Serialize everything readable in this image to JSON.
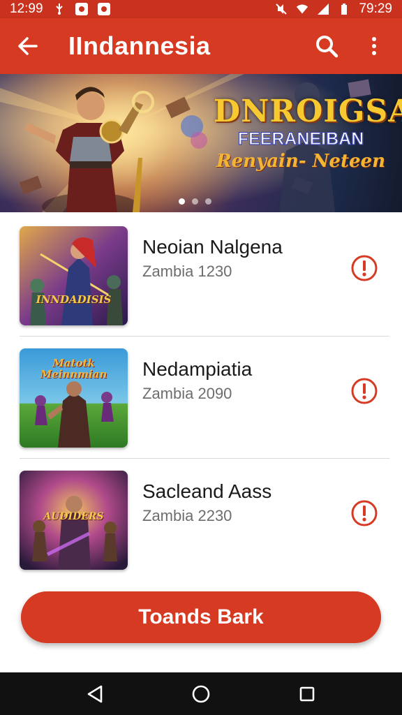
{
  "status_bar": {
    "time": "12:99",
    "clock_right": "79:29"
  },
  "app_bar": {
    "title": "IIndannesia"
  },
  "banner": {
    "line1": "DNROIGSA",
    "line2": "FEERANEIBAN",
    "line3": "Renyain- Neteen",
    "slide_count": 3,
    "active_slide": 1
  },
  "items": [
    {
      "name": "Neoian Nalgena",
      "sub": "Zambia 1230",
      "thumb_caption": "INNDADISIS"
    },
    {
      "name": "Nedampiatia",
      "sub": "Zambia 2090",
      "thumb_caption": "Matotk Meinnmian"
    },
    {
      "name": "Sacleand Aass",
      "sub": "Zambia 2230",
      "thumb_caption": "AUDIDERS"
    }
  ],
  "primary_button": {
    "label": "Toands Bark"
  },
  "icons": [
    "arrow-back-icon",
    "search-icon",
    "more-vert-icon",
    "alert-circle-icon",
    "nav-back-icon",
    "nav-home-icon",
    "nav-recents-icon"
  ],
  "colors": {
    "accent": "#d63a22",
    "status_bar": "#c8321f",
    "nav_bar": "#111111"
  }
}
